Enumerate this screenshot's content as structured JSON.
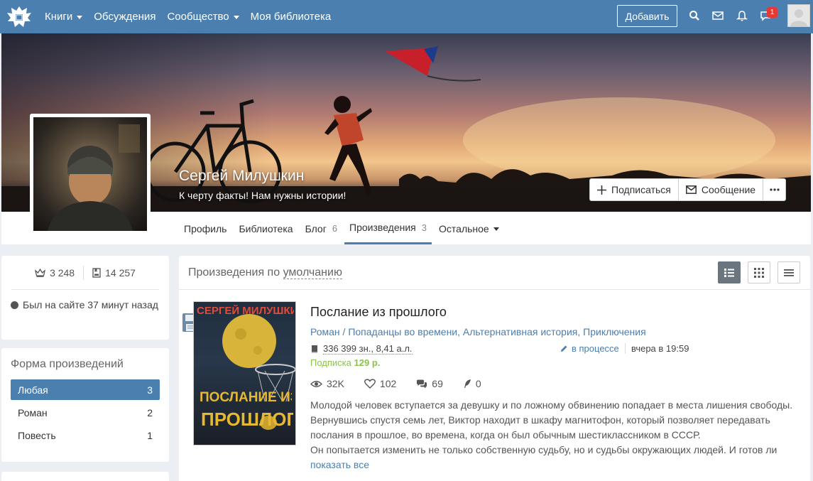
{
  "topnav": {
    "items": [
      {
        "label": "Книги",
        "dropdown": true
      },
      {
        "label": "Обсуждения",
        "dropdown": false
      },
      {
        "label": "Сообщество",
        "dropdown": true
      },
      {
        "label": "Моя библиотека",
        "dropdown": false
      }
    ],
    "add_label": "Добавить",
    "notification_count": "1",
    "icons": [
      "search-icon",
      "mail-icon",
      "bell-icon",
      "chat-icon"
    ]
  },
  "profile": {
    "name": "Сергей Милушкин",
    "tagline": "К черту факты! Нам нужны истории!",
    "actions": {
      "subscribe": "Подписаться",
      "message": "Сообщение"
    },
    "tabs": [
      {
        "label": "Профиль",
        "count": ""
      },
      {
        "label": "Библиотека",
        "count": ""
      },
      {
        "label": "Блог",
        "count": "6"
      },
      {
        "label": "Произведения",
        "count": "3",
        "active": true
      },
      {
        "label": "Остальное",
        "count": "",
        "dropdown": true
      }
    ]
  },
  "sidebar": {
    "stats": {
      "rating": "3 248",
      "followers": "14 257"
    },
    "last_seen": "Был на сайте 37 минут назад",
    "form_title": "Форма произведений",
    "forms": [
      {
        "label": "Любая",
        "count": "3",
        "active": true
      },
      {
        "label": "Роман",
        "count": "2"
      },
      {
        "label": "Повесть",
        "count": "1"
      }
    ]
  },
  "works": {
    "title_prefix": "Произведения по",
    "sort_label": "умолчанию",
    "items": [
      {
        "title": "Послание из прошлого",
        "genre_main": "Роман",
        "genres": "Попаданцы во времени",
        "genre_2": "Альтернативная история",
        "genre_3": "Приключения",
        "size": "336 399 зн., 8,41 а.л.",
        "status": "в процессе",
        "updated": "вчера в 19:59",
        "subscription_label": "Подписка",
        "price": "129 р.",
        "views": "32K",
        "likes": "102",
        "comments": "69",
        "rewards": "0",
        "annotation_1": "Молодой человек вступается за девушку и по ложному обвинению попадает в места лишения свободы. Вернувшись спустя семь лет, Виктор находит в шкафу магнитофон, который позволяет передавать послания в прошлое, во времена, когда он был обычным шестиклассником в СССР.",
        "annotation_2": "Он попытается изменить не только собственную судьбу, но и судьбы окружающих людей. И готов ли",
        "show_all": "показать все",
        "cover_author": "СЕРГЕЙ МИЛУШКИН",
        "cover_title_1": "ПОСЛАНИЕ ИЗ",
        "cover_title_2": "ПРОШЛОГО"
      }
    ]
  },
  "colors": {
    "brand": "#4a7fb0",
    "price": "#8bc34a",
    "badge": "#e53935"
  }
}
